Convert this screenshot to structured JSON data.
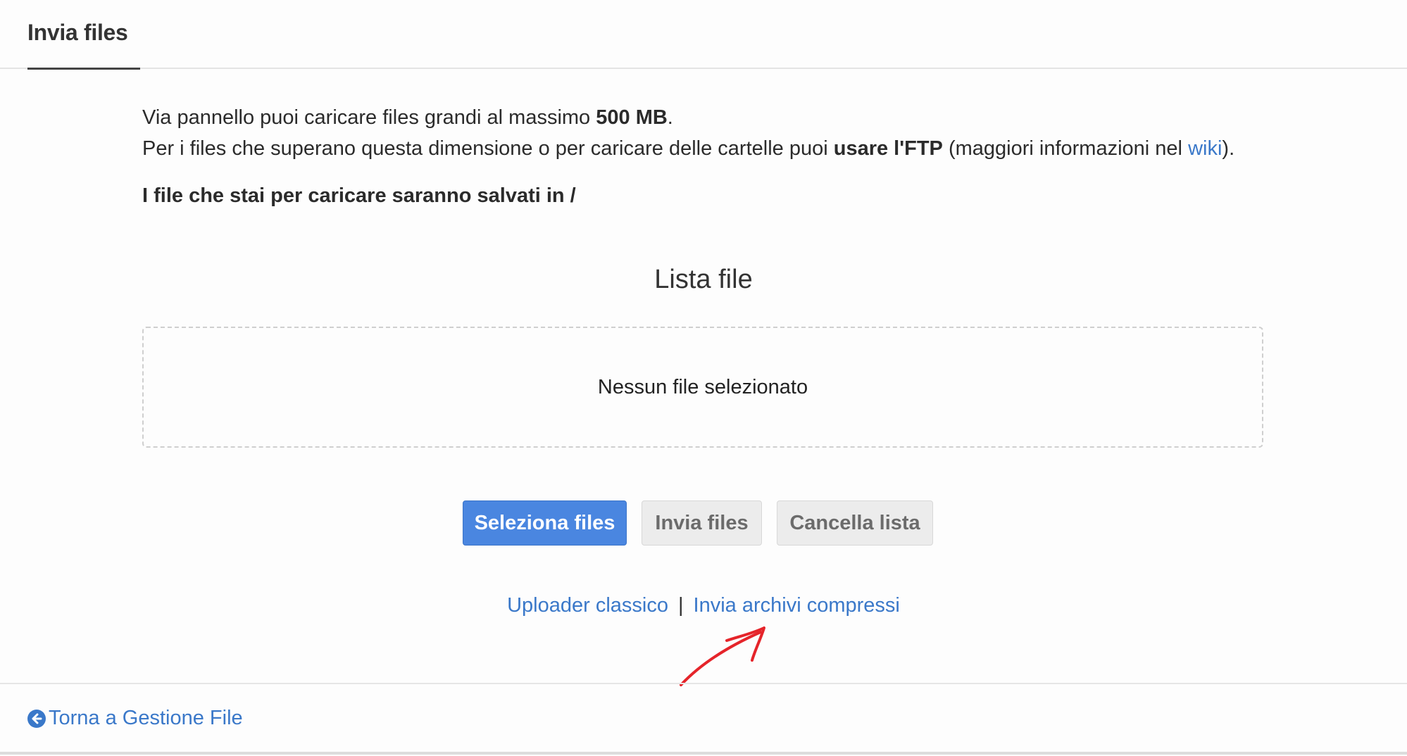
{
  "header": {
    "tab_title": "Invia files"
  },
  "intro": {
    "line1_prefix": "Via pannello puoi caricare files grandi al massimo ",
    "line1_size": "500 MB",
    "line1_suffix": ".",
    "line2_prefix": "Per i files che superano questa dimensione o per caricare delle cartelle puoi ",
    "line2_bold": "usare l'FTP",
    "line2_mid": " (maggiori informazioni nel ",
    "line2_link": "wiki",
    "line2_suffix": ")."
  },
  "destination_note": "I file che stai per caricare saranno salvati in /",
  "file_list": {
    "title": "Lista file",
    "empty_text": "Nessun file selezionato"
  },
  "buttons": {
    "select": "Seleziona files",
    "send": "Invia files",
    "clear": "Cancella lista"
  },
  "links": {
    "classic_uploader": "Uploader classico",
    "separator": "|",
    "compressed_archives": "Invia archivi compressi"
  },
  "footer": {
    "back_link": "Torna a Gestione File",
    "back_icon": "arrow-circle-left-icon"
  },
  "colors": {
    "accent": "#4a86e0",
    "link": "#3a78c9",
    "annotation_arrow": "#e5242a"
  }
}
